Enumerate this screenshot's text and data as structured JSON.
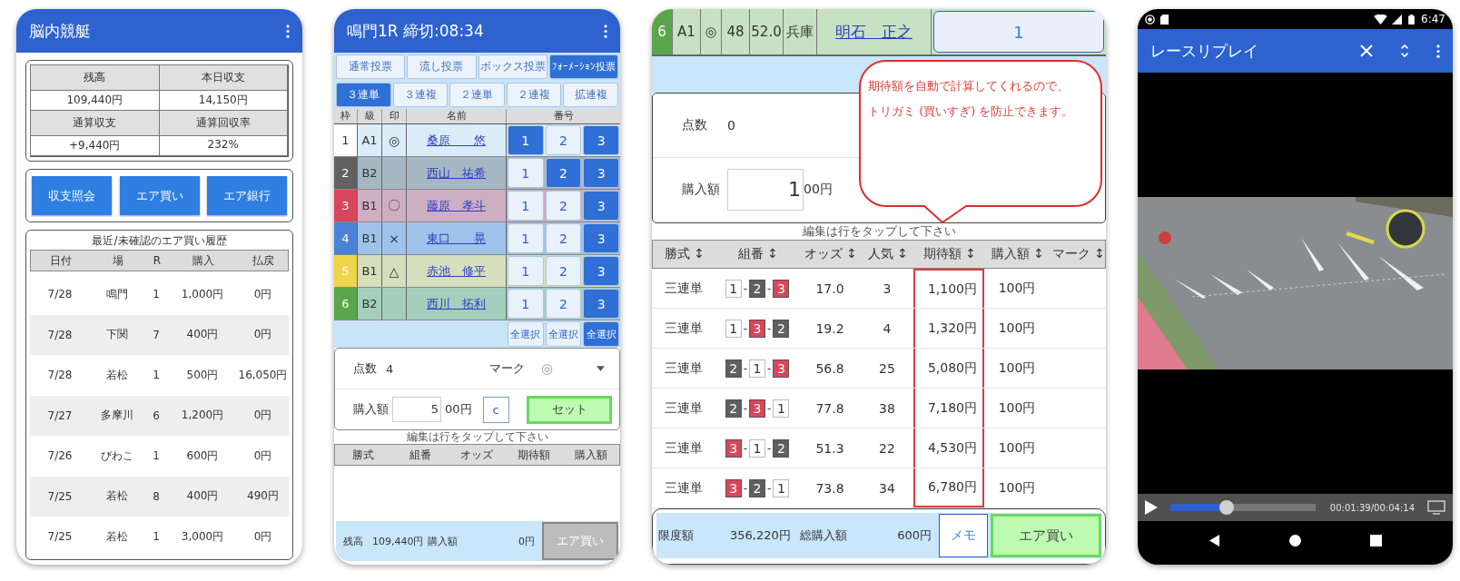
{
  "home": {
    "title": "脳内競艇",
    "summary": [
      {
        "label": "残高",
        "value": "109,440円"
      },
      {
        "label": "本日収支",
        "value": "14,150円"
      },
      {
        "label": "通算収支",
        "value": "+9,440円"
      },
      {
        "label": "通算回収率",
        "value": "232%"
      }
    ],
    "buttons": [
      "収支照会",
      "エア買い",
      "エア銀行"
    ],
    "history": {
      "title": "最近/未確認のエア買い履歴",
      "columns": [
        "日付",
        "場",
        "R",
        "購入",
        "払戻"
      ],
      "rows": [
        [
          "7/28",
          "鳴門",
          "1",
          "1,000円",
          "0円"
        ],
        [
          "7/28",
          "下関",
          "7",
          "400円",
          "0円"
        ],
        [
          "7/28",
          "若松",
          "1",
          "500円",
          "16,050円"
        ],
        [
          "7/27",
          "多摩川",
          "6",
          "1,200円",
          "0円"
        ],
        [
          "7/26",
          "びわこ",
          "1",
          "600円",
          "0円"
        ],
        [
          "7/25",
          "若松",
          "8",
          "400円",
          "490円"
        ],
        [
          "7/25",
          "若松",
          "1",
          "3,000円",
          "0円"
        ]
      ]
    }
  },
  "formation": {
    "title": "鳴門1R 締切:08:34",
    "bet_types": [
      {
        "label": "通常投票",
        "selected": false
      },
      {
        "label": "流し投票",
        "selected": false
      },
      {
        "label": "ボックス投票",
        "selected": false
      },
      {
        "label": "ﾌｫｰﾒｰｼｮﾝ投票",
        "selected": true
      }
    ],
    "ticket_types": [
      {
        "label": "３連単",
        "selected": true
      },
      {
        "label": "３連複",
        "selected": false
      },
      {
        "label": "２連単",
        "selected": false
      },
      {
        "label": "２連複",
        "selected": false
      },
      {
        "label": "拡連複",
        "selected": false
      }
    ],
    "columns": [
      "枠",
      "級",
      "印",
      "名前",
      "番号"
    ],
    "rows": [
      {
        "frame": "1",
        "color": "#ffffff",
        "class": "A1",
        "mark": "◎",
        "name": "桑原　　悠",
        "picks": [
          {
            "label": "1",
            "selected": true
          },
          {
            "label": "2",
            "selected": false
          },
          {
            "label": "3",
            "selected": true
          }
        ]
      },
      {
        "frame": "2",
        "color": "#616161",
        "class": "B2",
        "name": "西山　祐希",
        "picks": [
          {
            "label": "1",
            "selected": false
          },
          {
            "label": "2",
            "selected": true
          },
          {
            "label": "3",
            "selected": true
          }
        ]
      },
      {
        "frame": "3",
        "color": "#d9455b",
        "class": "B1",
        "mark": "〇",
        "name": "藤原　孝斗",
        "picks": [
          {
            "label": "1",
            "selected": false
          },
          {
            "label": "2",
            "selected": false
          },
          {
            "label": "3",
            "selected": true
          }
        ]
      },
      {
        "frame": "4",
        "color": "#4a82d6",
        "class": "B1",
        "mark": "×",
        "name": "東口　　晃",
        "picks": [
          {
            "label": "1",
            "selected": false
          },
          {
            "label": "2",
            "selected": false
          },
          {
            "label": "3",
            "selected": true
          }
        ]
      },
      {
        "frame": "5",
        "color": "#f0d54a",
        "class": "B1",
        "mark": "△",
        "name": "赤池　修平",
        "picks": [
          {
            "label": "1",
            "selected": false
          },
          {
            "label": "2",
            "selected": false
          },
          {
            "label": "3",
            "selected": true
          }
        ]
      },
      {
        "frame": "6",
        "color": "#5aa64a",
        "class": "B2",
        "name": "西川　拓利",
        "picks": [
          {
            "label": "1",
            "selected": false
          },
          {
            "label": "2",
            "selected": false
          },
          {
            "label": "3",
            "selected": true
          }
        ]
      }
    ],
    "select_all": [
      {
        "label": "全選択",
        "selected": false
      },
      {
        "label": "全選択",
        "selected": false
      },
      {
        "label": "全選択",
        "selected": true
      }
    ],
    "points_label": "点数",
    "points": "4",
    "mark_label": "マーク",
    "mark": "◎",
    "amount_label": "購入額",
    "amount_input": "5",
    "amount_unit": "00円",
    "clear_button": "c",
    "set_button": "セット",
    "hint": "編集は行をタップして下さい",
    "list_columns": [
      "勝式",
      "組番",
      "オッズ",
      "期待額",
      "購入額"
    ],
    "footer": {
      "balance_label": "残高",
      "balance": "109,440円",
      "amount_label": "購入額",
      "amount": "0円",
      "buy_button": {
        "label": "エア買い",
        "disabled": true
      }
    }
  },
  "bet_list": {
    "racer": {
      "frame": "6",
      "color": "#5aa64a",
      "class": "A1",
      "mark": "◎",
      "age": "48",
      "weight": "52.0",
      "branch": "兵庫",
      "name": "明石　正之",
      "pick": "1"
    },
    "points_label": "点数",
    "points": "0",
    "amount_label": "購入額",
    "amount_input": "1",
    "amount_unit": "00円",
    "callout": [
      "期待額を自動で計算してくれるので、",
      "トリガミ (買いすぎ) を防止できます。"
    ],
    "separator": "-",
    "hint": "編集は行をタップして下さい",
    "columns": [
      "勝式 ↕",
      "組番 ↕",
      "オッズ ↕",
      "人気 ↕",
      "期待額 ↕",
      "購入額 ↕",
      "マーク ↕"
    ],
    "rows": [
      {
        "type": "三連単",
        "combo": [
          {
            "n": "1",
            "color": "#ffffff"
          },
          {
            "n": "2",
            "color": "#5f5f5f"
          },
          {
            "n": "3",
            "color": "#d9455b"
          }
        ],
        "odds": "17.0",
        "popularity": "3",
        "expected": "1,100円",
        "amount": "100円"
      },
      {
        "type": "三連単",
        "combo": [
          {
            "n": "1",
            "color": "#ffffff"
          },
          {
            "n": "3",
            "color": "#d9455b"
          },
          {
            "n": "2",
            "color": "#5f5f5f"
          }
        ],
        "odds": "19.2",
        "popularity": "4",
        "expected": "1,320円",
        "amount": "100円"
      },
      {
        "type": "三連単",
        "combo": [
          {
            "n": "2",
            "color": "#5f5f5f"
          },
          {
            "n": "1",
            "color": "#ffffff"
          },
          {
            "n": "3",
            "color": "#d9455b"
          }
        ],
        "odds": "56.8",
        "popularity": "25",
        "expected": "5,080円",
        "amount": "100円"
      },
      {
        "type": "三連単",
        "combo": [
          {
            "n": "2",
            "color": "#5f5f5f"
          },
          {
            "n": "3",
            "color": "#d9455b"
          },
          {
            "n": "1",
            "color": "#ffffff"
          }
        ],
        "odds": "77.8",
        "popularity": "38",
        "expected": "7,180円",
        "amount": "100円"
      },
      {
        "type": "三連単",
        "combo": [
          {
            "n": "3",
            "color": "#d9455b"
          },
          {
            "n": "1",
            "color": "#ffffff"
          },
          {
            "n": "2",
            "color": "#5f5f5f"
          }
        ],
        "odds": "51.3",
        "popularity": "22",
        "expected": "4,530円",
        "amount": "100円"
      },
      {
        "type": "三連単",
        "combo": [
          {
            "n": "3",
            "color": "#d9455b"
          },
          {
            "n": "2",
            "color": "#5f5f5f"
          },
          {
            "n": "1",
            "color": "#ffffff"
          }
        ],
        "odds": "73.8",
        "popularity": "34",
        "expected": "6,780円",
        "amount": "100円"
      }
    ],
    "footer": {
      "limit_label": "限度額",
      "limit": "356,220円",
      "total_label": "総購入額",
      "total": "600円",
      "memo_button": "メモ",
      "buy_button": "エア買い"
    }
  },
  "replay": {
    "clock": "6:47",
    "title": "レースリプレイ",
    "player": {
      "level": 0.39,
      "time": "00:01:39/00:04:14"
    }
  }
}
